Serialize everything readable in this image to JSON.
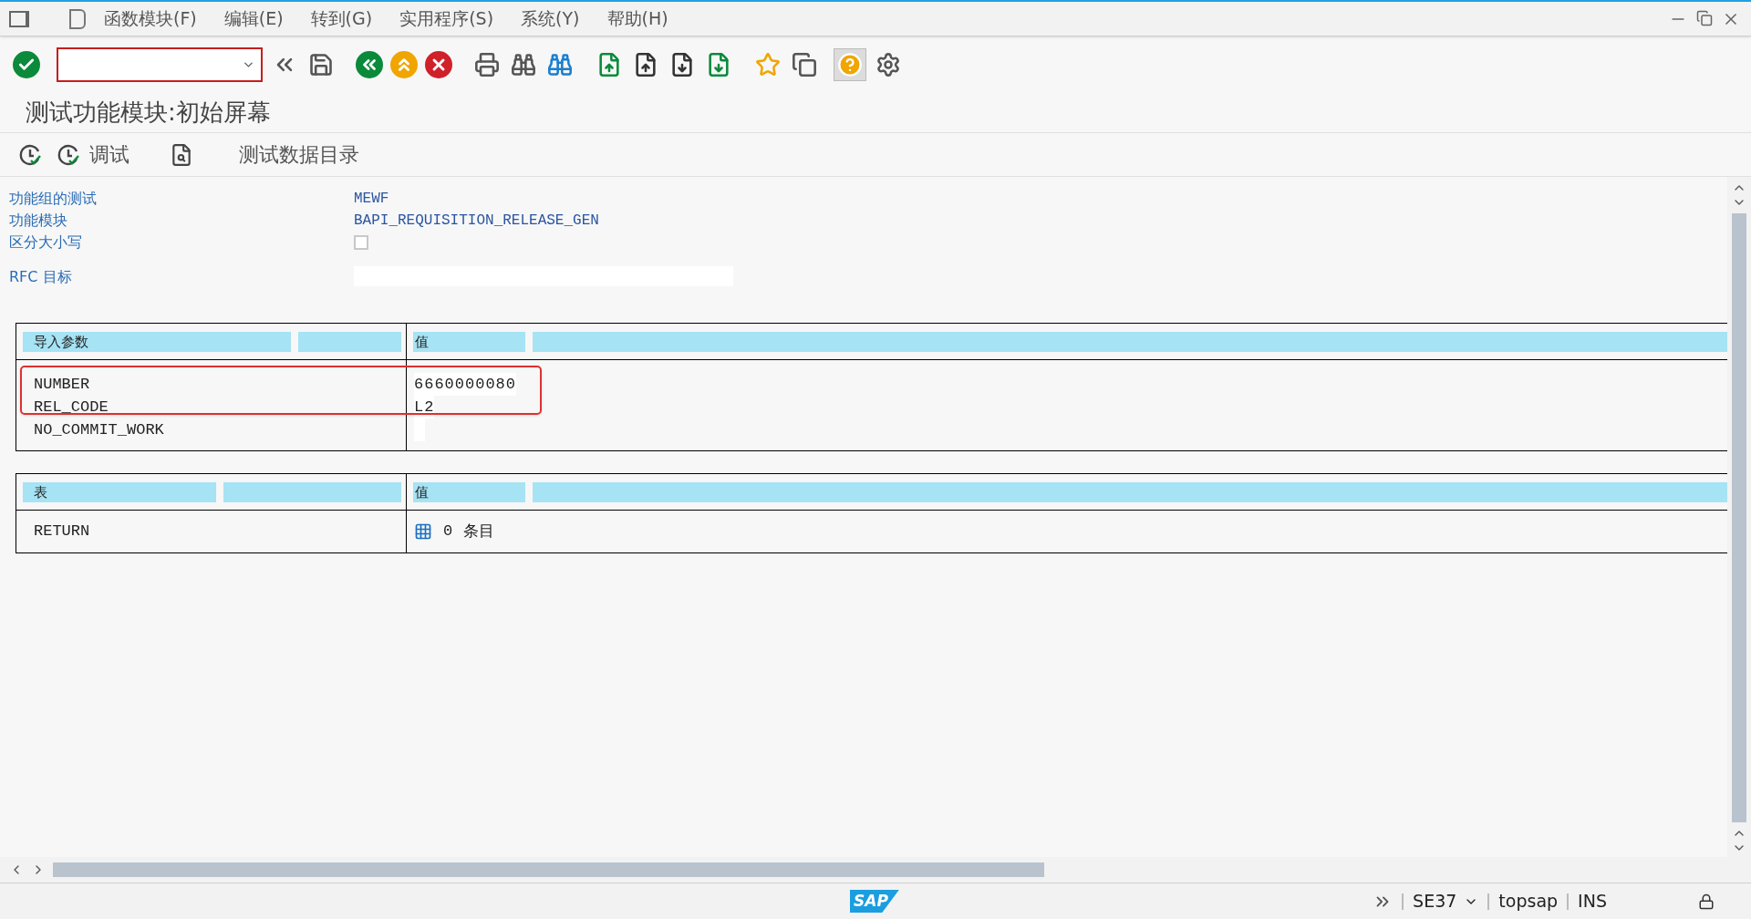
{
  "menu": [
    "函数模块(F)",
    "编辑(E)",
    "转到(G)",
    "实用程序(S)",
    "系统(Y)",
    "帮助(H)"
  ],
  "title": "测试功能模块:初始屏幕",
  "app_toolbar": [
    {
      "kind": "icon"
    },
    {
      "kind": "text",
      "label": "调试"
    },
    {
      "kind": "spacer"
    },
    {
      "kind": "text",
      "label": "测试数据目录"
    }
  ],
  "fields": [
    {
      "kind": "text",
      "label": "功能组的测试",
      "value": "MEWF"
    },
    {
      "kind": "text",
      "label": "功能模块",
      "value": "BAPI_REQUISITION_RELEASE_GEN"
    },
    {
      "kind": "checkbox",
      "label": "区分大小写",
      "checked": false
    },
    {
      "kind": "input",
      "label": "RFC 目标"
    }
  ],
  "import_table": {
    "columns": [
      "导入参数",
      "值"
    ],
    "rows": [
      {
        "name": "NUMBER",
        "value": "6660000080",
        "highlighted": true
      },
      {
        "name": "REL_CODE",
        "value": "L2",
        "highlighted": true
      },
      {
        "name": "NO_COMMIT_WORK",
        "value": "",
        "highlighted": false
      }
    ]
  },
  "tables_table": {
    "columns": [
      "表",
      "值"
    ],
    "rows": [
      {
        "name": "RETURN",
        "count": "0",
        "unit": "条目"
      }
    ]
  },
  "logo": "SAP",
  "status_bar": {
    "transaction": "SE37",
    "system": "topsap",
    "mode": "INS"
  }
}
